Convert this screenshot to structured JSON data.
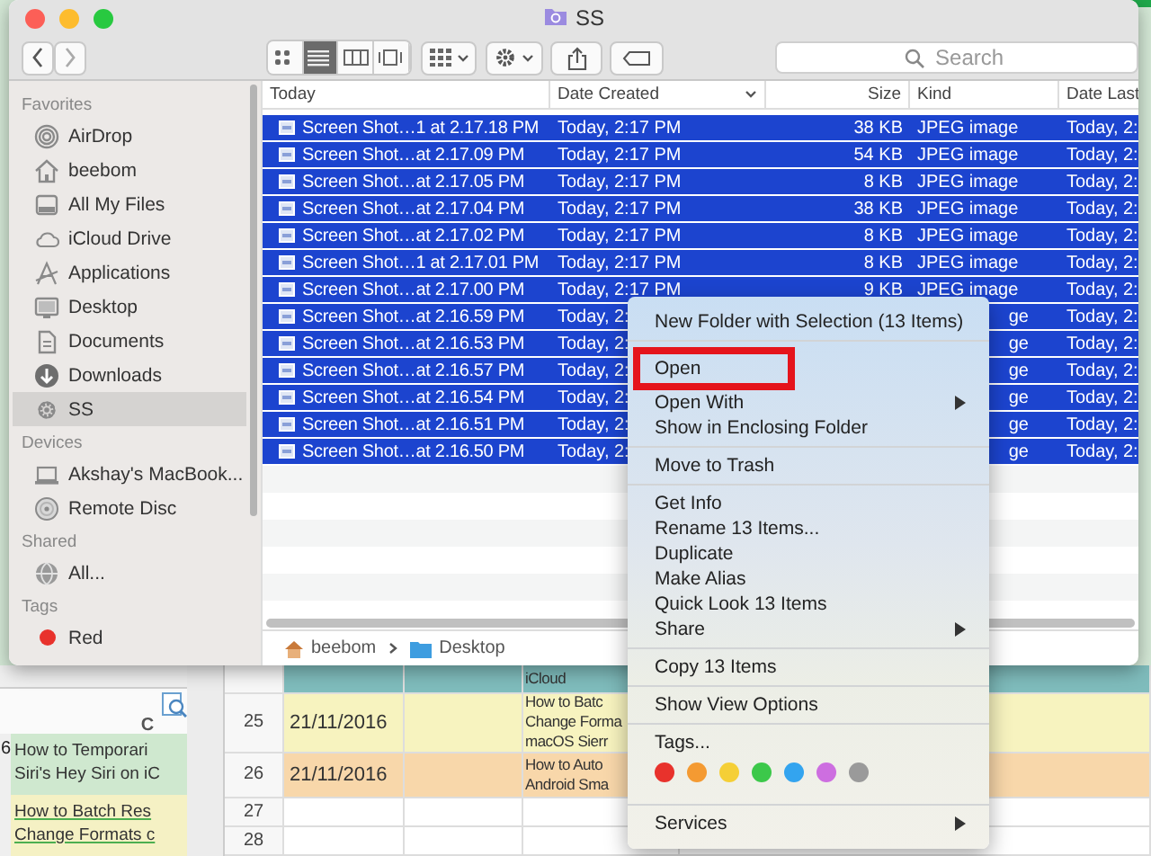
{
  "window": {
    "title": "SS"
  },
  "toolbar": {
    "search_placeholder": "Search",
    "view_modes": [
      {
        "kind": "icons",
        "selected": false
      },
      {
        "kind": "list",
        "selected": true
      },
      {
        "kind": "columns",
        "selected": false
      },
      {
        "kind": "cover",
        "selected": false
      }
    ]
  },
  "sidebar": {
    "sections": [
      {
        "heading": "Favorites",
        "items": [
          {
            "label": "AirDrop",
            "kind": "airdrop",
            "selected": false
          },
          {
            "label": "beebom",
            "kind": "home",
            "selected": false
          },
          {
            "label": "All My Files",
            "kind": "files",
            "selected": false
          },
          {
            "label": "iCloud Drive",
            "kind": "cloud",
            "selected": false
          },
          {
            "label": "Applications",
            "kind": "apps",
            "selected": false
          },
          {
            "label": "Desktop",
            "kind": "desktop",
            "selected": false
          },
          {
            "label": "Documents",
            "kind": "documents",
            "selected": false
          },
          {
            "label": "Downloads",
            "kind": "downloads",
            "selected": false
          },
          {
            "label": "SS",
            "kind": "gear",
            "selected": true
          }
        ]
      },
      {
        "heading": "Devices",
        "items": [
          {
            "label": "Akshay's MacBook...",
            "kind": "laptop",
            "selected": false
          },
          {
            "label": "Remote Disc",
            "kind": "disc",
            "selected": false
          }
        ]
      },
      {
        "heading": "Shared",
        "items": [
          {
            "label": "All...",
            "kind": "globe",
            "selected": false
          }
        ]
      },
      {
        "heading": "Tags",
        "items": [
          {
            "label": "Red",
            "kind": "tag",
            "color": "#e8322c",
            "selected": false
          }
        ]
      }
    ]
  },
  "columns": [
    {
      "label": "Today",
      "sorted": false
    },
    {
      "label": "Date Created",
      "sorted": true
    },
    {
      "label": "Size",
      "sorted": false
    },
    {
      "label": "Kind",
      "sorted": false
    },
    {
      "label": "Date Last",
      "sorted": false
    }
  ],
  "files": [
    {
      "name": "Screen Shot…1 at 2.17.18 PM",
      "date_created": "Today, 2:17 PM",
      "size": "38 KB",
      "kind": "JPEG image",
      "date_last": "Today, 2:",
      "selected": true
    },
    {
      "name": "Screen Shot…at 2.17.09 PM",
      "date_created": "Today, 2:17 PM",
      "size": "54 KB",
      "kind": "JPEG image",
      "date_last": "Today, 2:",
      "selected": true
    },
    {
      "name": "Screen Shot…at 2.17.05 PM",
      "date_created": "Today, 2:17 PM",
      "size": "8 KB",
      "kind": "JPEG image",
      "date_last": "Today, 2:",
      "selected": true
    },
    {
      "name": "Screen Shot…at 2.17.04 PM",
      "date_created": "Today, 2:17 PM",
      "size": "38 KB",
      "kind": "JPEG image",
      "date_last": "Today, 2:",
      "selected": true
    },
    {
      "name": "Screen Shot…at 2.17.02 PM",
      "date_created": "Today, 2:17 PM",
      "size": "8 KB",
      "kind": "JPEG image",
      "date_last": "Today, 2:",
      "selected": true
    },
    {
      "name": "Screen Shot…1 at 2.17.01 PM",
      "date_created": "Today, 2:17 PM",
      "size": "8 KB",
      "kind": "JPEG image",
      "date_last": "Today, 2:",
      "selected": true
    },
    {
      "name": "Screen Shot…at 2.17.00 PM",
      "date_created": "Today, 2:17 PM",
      "size": "9 KB",
      "kind": "JPEG image",
      "date_last": "Today, 2:",
      "selected": true
    },
    {
      "name": "Screen Shot…at 2.16.59 PM",
      "date_created": "Today, 2:",
      "kind_end": "ge",
      "date_last": "Today, 2:",
      "selected": true
    },
    {
      "name": "Screen Shot…at 2.16.53 PM",
      "date_created": "Today, 2:",
      "kind_end": "ge",
      "date_last": "Today, 2:",
      "selected": true
    },
    {
      "name": "Screen Shot…at 2.16.57 PM",
      "date_created": "Today, 2:",
      "kind_end": "ge",
      "date_last": "Today, 2:",
      "selected": true
    },
    {
      "name": "Screen Shot…at 2.16.54 PM",
      "date_created": "Today, 2:",
      "kind_end": "ge",
      "date_last": "Today, 2:",
      "selected": true
    },
    {
      "name": "Screen Shot…at 2.16.51 PM",
      "date_created": "Today, 2:",
      "kind_end": "ge",
      "date_last": "Today, 2:",
      "selected": true
    },
    {
      "name": "Screen Shot…at 2.16.50 PM",
      "date_created": "Today, 2:",
      "kind_end": "ge",
      "date_last": "Today, 2:",
      "selected": true
    }
  ],
  "path_bar": [
    {
      "label": "beebom",
      "kind": "home"
    },
    {
      "label": "Desktop",
      "kind": "folder"
    }
  ],
  "context_menu": {
    "sections": [
      {
        "items": [
          {
            "label": "New Folder with Selection (13 Items)",
            "submenu": false,
            "boxed": false
          }
        ]
      },
      {
        "items": [
          {
            "label": "Open",
            "submenu": false,
            "boxed": true
          },
          {
            "label": "Open With",
            "submenu": true,
            "boxed": false
          },
          {
            "label": "Show in Enclosing Folder",
            "submenu": false,
            "boxed": false
          }
        ]
      },
      {
        "items": [
          {
            "label": "Move to Trash",
            "submenu": false,
            "boxed": false
          }
        ]
      },
      {
        "items": [
          {
            "label": "Get Info",
            "submenu": false,
            "boxed": false
          },
          {
            "label": "Rename 13 Items...",
            "submenu": false,
            "boxed": false
          },
          {
            "label": "Duplicate",
            "submenu": false,
            "boxed": false
          },
          {
            "label": "Make Alias",
            "submenu": false,
            "boxed": false
          },
          {
            "label": "Quick Look 13 Items",
            "submenu": false,
            "boxed": false
          },
          {
            "label": "Share",
            "submenu": true,
            "boxed": false
          }
        ]
      },
      {
        "items": [
          {
            "label": "Copy 13 Items",
            "submenu": false,
            "boxed": false
          }
        ]
      },
      {
        "items": [
          {
            "label": "Show View Options",
            "submenu": false,
            "boxed": false
          }
        ]
      },
      {
        "items": [
          {
            "label": "Tags...",
            "submenu": false,
            "boxed": false
          }
        ],
        "tags": [
          {
            "color": "#e8322c"
          },
          {
            "color": "#f49a32"
          },
          {
            "color": "#f5cf36"
          },
          {
            "color": "#3cc84a"
          },
          {
            "color": "#33a4ef"
          },
          {
            "color": "#cd6ee0"
          },
          {
            "color": "#9a9a9a"
          }
        ]
      },
      {
        "items": [
          {
            "label": "Services",
            "submenu": true,
            "boxed": false
          }
        ]
      }
    ]
  },
  "sheet": {
    "panel": {
      "column": "C",
      "rows": [
        {
          "number": "6",
          "lines": [
            "How to Temporari",
            "Siri's Hey Siri on iC"
          ],
          "color": "#cfe8cf",
          "link": false
        },
        {
          "lines": [
            "How to Batch Res",
            "Change Formats c"
          ],
          "color": "#f5f1c4",
          "link": true
        }
      ]
    },
    "rows": [
      {
        "color": "#7fbcbc",
        "date": "",
        "lines": [
          "iCloud"
        ]
      },
      {
        "number": "25",
        "color": "#f7f3bf",
        "date": "21/11/2016",
        "lines": [
          "How to Batc",
          "Change Forma",
          "macOS Sierr"
        ]
      },
      {
        "number": "26",
        "color": "#f8d7aa",
        "date": "21/11/2016",
        "lines": [
          "How to Auto",
          "Android Sma"
        ]
      },
      {
        "number": "27",
        "color": "#ffffff",
        "date": "",
        "lines": []
      },
      {
        "number": "28",
        "color": "#ffffff",
        "date": "",
        "lines": []
      }
    ]
  }
}
